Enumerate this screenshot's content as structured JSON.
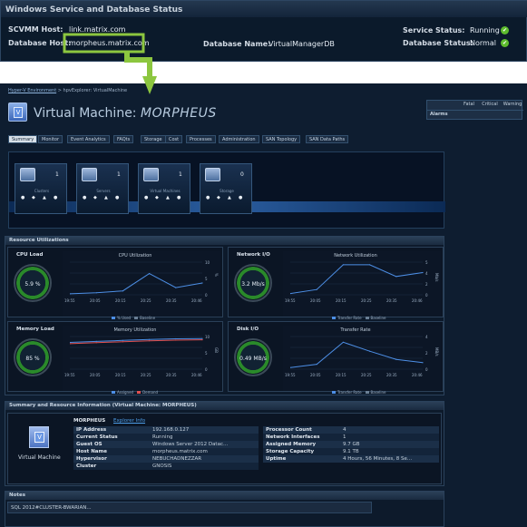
{
  "header": {
    "title": "Windows Service and Database Status",
    "scvmm_host_label": "SCVMM Host:",
    "scvmm_host_value": "link.matrix.com",
    "database_host_label": "Database Host:",
    "database_host_value": "morpheus.matrix.com",
    "database_name_label": "Database Name:",
    "database_name_value": "VirtualManagerDB",
    "service_status_label": "Service Status:",
    "service_status_value": "Running",
    "database_status_label": "Database Status:",
    "database_status_value": "Normal",
    "ok_color": "#5dbb2d",
    "check_glyph": "✔"
  },
  "breadcrumb": {
    "root": "Hyper-V Environment",
    "sep": ">",
    "current": "hpvExplorer: VirtualMachine"
  },
  "page": {
    "title_prefix": "Virtual Machine:",
    "title_name": "MORPHEUS"
  },
  "alarms": {
    "label": "Alarms",
    "cols": [
      "Fatal",
      "Critical",
      "Warning"
    ]
  },
  "tabs": [
    "Summary",
    "Monitor",
    "Event Analytics",
    "FAQts",
    "Storage",
    "Cost",
    "Processes",
    "Administration",
    "SAN Topology",
    "SAN Data Paths"
  ],
  "topology": {
    "tiles": [
      {
        "label": "Clusters",
        "count": "1"
      },
      {
        "label": "Servers",
        "count": "1"
      },
      {
        "label": "Virtual Machines",
        "count": "1"
      },
      {
        "label": "Storage",
        "count": "0"
      }
    ]
  },
  "resource": {
    "title": "Resource Utilizations",
    "cpu": {
      "title": "CPU Load",
      "gauge": "5.9 %",
      "chart_title": "CPU Utilization",
      "legend": [
        "% Used",
        "Baseline"
      ],
      "yticks": [
        "10",
        "5",
        "0"
      ],
      "unit": "%",
      "xticks": [
        "19:55",
        "20:05",
        "20:15",
        "20:25",
        "20:35",
        "20:46"
      ]
    },
    "net": {
      "title": "Network I/O",
      "gauge": "3.2 Mb/s",
      "chart_title": "Network Utilization",
      "legend": [
        "Transfer Rate",
        "Baseline"
      ],
      "yticks": [
        "5",
        "4",
        "2",
        "0"
      ],
      "unit": "Mb/s",
      "xticks": [
        "19:55",
        "20:05",
        "20:15",
        "20:25",
        "20:35",
        "20:46"
      ]
    },
    "mem": {
      "title": "Memory Load",
      "gauge": "85 %",
      "chart_title": "Memory Utilization",
      "legend": [
        "Assigned",
        "Demand"
      ],
      "yticks": [
        "10",
        "5",
        "0"
      ],
      "unit": "GB",
      "xticks": [
        "19:55",
        "20:05",
        "20:15",
        "20:25",
        "20:35",
        "20:46"
      ]
    },
    "disk": {
      "title": "Disk I/O",
      "gauge": "0.49 MB/s",
      "chart_title": "Transfer Rate",
      "legend": [
        "Transfer Rate",
        "Baseline"
      ],
      "yticks": [
        "4",
        "2",
        "0"
      ],
      "unit": "MB/s",
      "xticks": [
        "19:55",
        "20:05",
        "20:15",
        "20:25",
        "20:35",
        "20:46"
      ]
    }
  },
  "chart_data": [
    {
      "type": "line",
      "title": "CPU Utilization",
      "x": [
        "19:55",
        "20:05",
        "20:15",
        "20:25",
        "20:35",
        "20:46"
      ],
      "series": [
        {
          "name": "% Used",
          "values": [
            0.3,
            0.6,
            1.2,
            6.5,
            2.2,
            3.6
          ]
        }
      ],
      "ylim": [
        0,
        10
      ]
    },
    {
      "type": "line",
      "title": "Network Utilization",
      "x": [
        "19:55",
        "20:05",
        "20:15",
        "20:25",
        "20:35",
        "20:46"
      ],
      "series": [
        {
          "name": "Transfer Rate",
          "values": [
            0.2,
            0.8,
            4.6,
            4.6,
            2.8,
            3.4
          ]
        }
      ],
      "ylim": [
        0,
        5
      ]
    },
    {
      "type": "line",
      "title": "Memory Utilization",
      "x": [
        "19:55",
        "20:05",
        "20:15",
        "20:25",
        "20:35",
        "20:46"
      ],
      "series": [
        {
          "name": "Assigned",
          "values": [
            8.2,
            8.5,
            8.8,
            9.1,
            9.3,
            9.4
          ]
        },
        {
          "name": "Demand",
          "values": [
            7.8,
            8.1,
            8.4,
            8.7,
            8.9,
            9.0
          ]
        }
      ],
      "ylim": [
        0,
        10
      ]
    },
    {
      "type": "line",
      "title": "Transfer Rate",
      "x": [
        "19:55",
        "20:05",
        "20:15",
        "20:25",
        "20:35",
        "20:46"
      ],
      "series": [
        {
          "name": "Transfer Rate",
          "values": [
            0.2,
            0.6,
            3.3,
            2.2,
            1.2,
            0.8
          ]
        }
      ],
      "ylim": [
        0,
        4
      ]
    }
  ],
  "summary": {
    "title": "Summary and Resource Information (Virtual Machine: MORPHEUS)",
    "icon_label": "Virtual Machine",
    "vm_name": "MORPHEUS",
    "explorer_link": "Explorer Info",
    "left": [
      {
        "k": "IP Address",
        "v": "192.168.0.127"
      },
      {
        "k": "Current Status",
        "v": "Running"
      },
      {
        "k": "Guest OS",
        "v": "Windows Server 2012 Datac..."
      },
      {
        "k": "Host Name",
        "v": "morpheus.matrix.com"
      },
      {
        "k": "Hypervisor",
        "v": "NEBUCHADNEZZAR"
      },
      {
        "k": "Cluster",
        "v": "GNOSIS"
      }
    ],
    "right": [
      {
        "k": "Processor Count",
        "v": "4"
      },
      {
        "k": "Network Interfaces",
        "v": "1"
      },
      {
        "k": "Assigned Memory",
        "v": "9.7 GB"
      },
      {
        "k": "Storage Capacity",
        "v": "9.1 TB"
      },
      {
        "k": "Uptime",
        "v": "4 Hours, 56 Minutes, 8 Se..."
      }
    ]
  },
  "notes": {
    "title": "Notes",
    "text": "SQL 2012#CLUSTER-BWARIAN..."
  }
}
